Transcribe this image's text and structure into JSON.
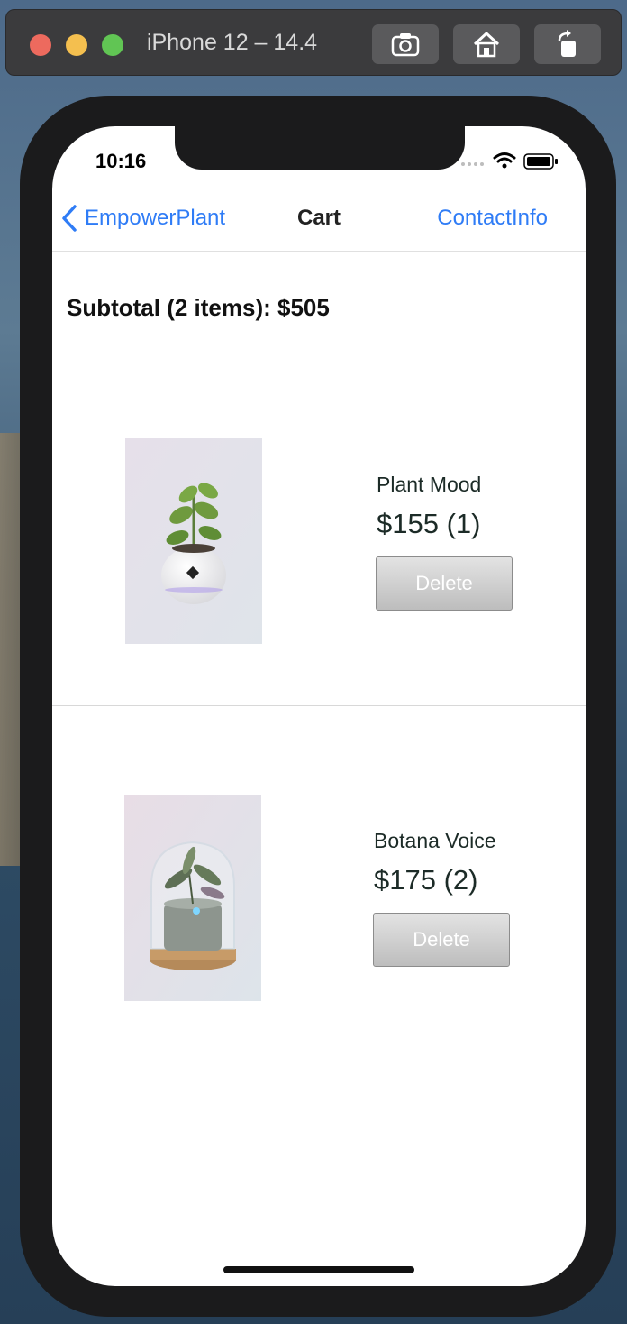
{
  "window": {
    "title": "iPhone 12 – 14.4",
    "toolbar_icons": [
      "screenshot-icon",
      "home-icon",
      "rotate-icon"
    ]
  },
  "status_bar": {
    "time": "10:16"
  },
  "nav": {
    "back_label": "EmpowerPlant",
    "title": "Cart",
    "right_label": "ContactInfo"
  },
  "cart": {
    "subtotal": "Subtotal (2 items): $505",
    "items": [
      {
        "name": "Plant Mood",
        "price": "$155 (1)",
        "delete_label": "Delete"
      },
      {
        "name": "Botana Voice",
        "price": "$175 (2)",
        "delete_label": "Delete"
      }
    ]
  },
  "colors": {
    "accent": "#2f7cf6",
    "text": "#1c2b27",
    "device": "#1b1b1c"
  }
}
